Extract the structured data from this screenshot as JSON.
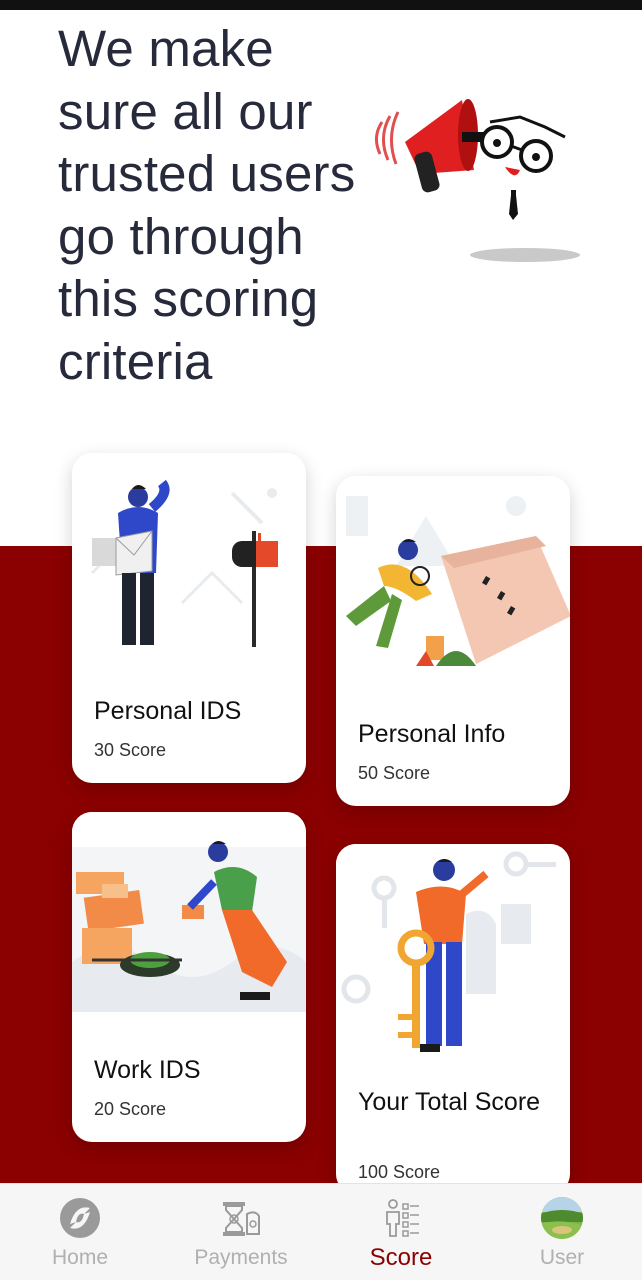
{
  "hero": {
    "title": "We make sure all our trusted users go through this scoring criteria"
  },
  "cards": [
    {
      "title": "Personal IDS",
      "score": "30 Score"
    },
    {
      "title": "Personal Info",
      "score": "50 Score"
    },
    {
      "title": "Work IDS",
      "score": "20 Score"
    },
    {
      "title": "Your Total Score",
      "score": "100 Score"
    }
  ],
  "bottom_nav": {
    "items": [
      {
        "label": "Home",
        "icon": "home-logo-icon"
      },
      {
        "label": "Payments",
        "icon": "payments-icon"
      },
      {
        "label": "Score",
        "icon": "score-checklist-icon"
      },
      {
        "label": "User",
        "icon": "user-avatar-icon"
      }
    ],
    "active": "Score"
  },
  "colors": {
    "accent": "#8b0000",
    "title_text": "#262a3b",
    "inactive_nav": "#b0b0b0"
  }
}
